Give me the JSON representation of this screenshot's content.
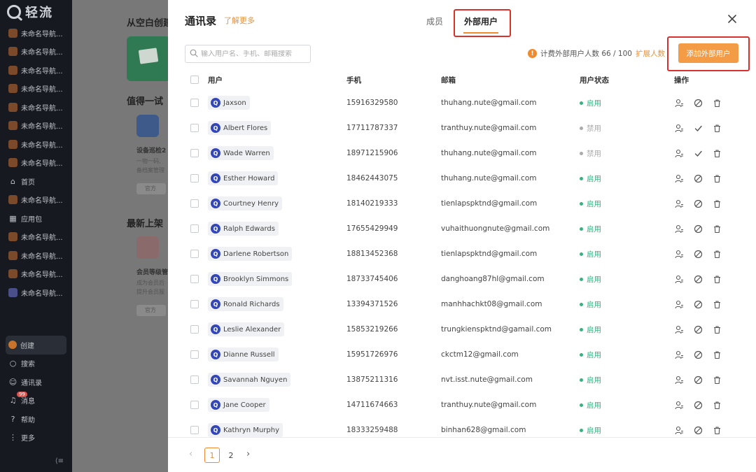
{
  "sidebar": {
    "logo_text": "轻流",
    "apps": [
      {
        "label": "未命名导航..."
      },
      {
        "label": "未命名导航..."
      },
      {
        "label": "未命名导航..."
      },
      {
        "label": "未命名导航..."
      },
      {
        "label": "未命名导航..."
      },
      {
        "label": "未命名导航..."
      },
      {
        "label": "未命名导航..."
      },
      {
        "label": "未命名导航..."
      },
      {
        "label": "首页"
      },
      {
        "label": "未命名导航..."
      },
      {
        "label": "应用包"
      },
      {
        "label": "未命名导航..."
      },
      {
        "label": "未命名导航..."
      },
      {
        "label": "未命名导航..."
      },
      {
        "label": "未命名导航..."
      }
    ],
    "bottom": [
      {
        "label": "创建"
      },
      {
        "label": "搜索"
      },
      {
        "label": "通讯录"
      },
      {
        "label": "消息"
      },
      {
        "label": "帮助"
      },
      {
        "label": "更多"
      }
    ],
    "badge": "99"
  },
  "background": {
    "section1_title": "从空白创建",
    "section2_title": "值得一试",
    "app1_name": "设备巡检2",
    "app1_desc1": "一物一码,",
    "app1_desc2": "备档案管理",
    "tag1": "官方",
    "section3_title": "最新上架",
    "app2_name": "会员等级管",
    "app2_desc1": "成为会员后",
    "app2_desc2": "提升会员服",
    "tag2": "官方"
  },
  "dialog": {
    "title": "通讯录",
    "learn_more": "了解更多",
    "tabs": [
      "成员",
      "外部用户"
    ],
    "search_placeholder": "输入用户名、手机、邮箱搜索",
    "quota_label": "计费外部用户人数 66 / 100",
    "expand_link": "扩展人数",
    "add_button": "添加外部用户",
    "columns": [
      "用户",
      "手机",
      "邮箱",
      "用户状态",
      "操作"
    ],
    "rows": [
      {
        "name": "Jaxson",
        "phone": "15916329580",
        "email": "thuhang.nute@gmail.com",
        "status": "启用",
        "enabled": true
      },
      {
        "name": "Albert Flores",
        "phone": "17711787337",
        "email": "tranthuy.nute@gmail.com",
        "status": "禁用",
        "enabled": false
      },
      {
        "name": "Wade Warren",
        "phone": "18971215906",
        "email": "thuhang.nute@gmail.com",
        "status": "禁用",
        "enabled": false
      },
      {
        "name": "Esther Howard",
        "phone": "18462443075",
        "email": "thuhang.nute@gmail.com",
        "status": "启用",
        "enabled": true
      },
      {
        "name": "Courtney Henry",
        "phone": "18140219333",
        "email": "tienlapspktnd@gmail.com",
        "status": "启用",
        "enabled": true
      },
      {
        "name": "Ralph Edwards",
        "phone": "17655429949",
        "email": "vuhaithuongnute@gmail.com",
        "status": "启用",
        "enabled": true
      },
      {
        "name": "Darlene Robertson",
        "phone": "18813452368",
        "email": "tienlapspktnd@gmail.com",
        "status": "启用",
        "enabled": true
      },
      {
        "name": "Brooklyn Simmons",
        "phone": "18733745406",
        "email": "danghoang87hl@gmail.com",
        "status": "启用",
        "enabled": true
      },
      {
        "name": "Ronald Richards",
        "phone": "13394371526",
        "email": "manhhachkt08@gmail.com",
        "status": "启用",
        "enabled": true
      },
      {
        "name": "Leslie Alexander",
        "phone": "15853219266",
        "email": "trungkienspktnd@gamail.com",
        "status": "启用",
        "enabled": true
      },
      {
        "name": "Dianne Russell",
        "phone": "15951726976",
        "email": "ckctm12@gmail.com",
        "status": "启用",
        "enabled": true
      },
      {
        "name": "Savannah Nguyen",
        "phone": "13875211316",
        "email": "nvt.isst.nute@gmail.com",
        "status": "启用",
        "enabled": true
      },
      {
        "name": "Jane Cooper",
        "phone": "14711674663",
        "email": "tranthuy.nute@gmail.com",
        "status": "启用",
        "enabled": true
      },
      {
        "name": "Kathryn Murphy",
        "phone": "18333259488",
        "email": "binhan628@gmail.com",
        "status": "启用",
        "enabled": true
      }
    ],
    "pagination": {
      "pages": [
        "1",
        "2"
      ],
      "current": "1"
    }
  },
  "colors": {
    "accent": "#f08a2c",
    "enabled": "#36b37e",
    "disabled": "#aaaaaa",
    "highlight": "#d9322e",
    "avatar": "#3447b8"
  },
  "icons": {
    "row_avatar": "Q",
    "warning": "!",
    "enabled_action": "ban-icon",
    "disabled_action": "check-icon"
  }
}
